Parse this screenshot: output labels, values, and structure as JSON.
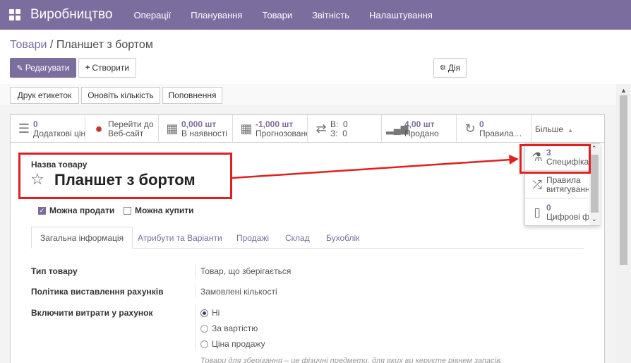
{
  "navbar": {
    "brand": "Виробництво",
    "menu": [
      "Операції",
      "Планування",
      "Товари",
      "Звітність",
      "Налаштування"
    ]
  },
  "breadcrumb": {
    "parent": "Товари",
    "separator": " / ",
    "current": "Планшет з бортом"
  },
  "buttons": {
    "edit": "Редагувати",
    "create": "Створити",
    "action": "Дія"
  },
  "header_buttons": [
    "Друк етикеток",
    "Оновіть кількість",
    "Поповнення"
  ],
  "smart_buttons": [
    {
      "icon": "list-icon",
      "value": "0",
      "label": "Додаткові ціни"
    },
    {
      "icon": "globe-icon",
      "value": "Перейти до",
      "label": "Веб-сайт"
    },
    {
      "icon": "cubes-icon",
      "value": "0,000 шт",
      "label": "В наявності"
    },
    {
      "icon": "cubes-forecast-icon",
      "value": "-1,000 шт",
      "label": "Прогнозовано"
    },
    {
      "icon": "exchange-icon",
      "value": "В:  0",
      "label": "З:  0"
    },
    {
      "icon": "signal-icon",
      "value": "4,00 шт",
      "label": "Продано"
    },
    {
      "icon": "refresh-icon",
      "value": "0",
      "label": "Правила поповнення"
    }
  ],
  "more_label": "Більше",
  "dropdown": [
    {
      "icon": "flask-icon",
      "value": "3",
      "label": "Специфікації"
    },
    {
      "icon": "shuffle-icon",
      "value": "Правила",
      "label": "витягування"
    },
    {
      "icon": "file-icon",
      "value": "0",
      "label": "Цифрові файли"
    }
  ],
  "form": {
    "name_label": "Назва товару",
    "product_name": "Планшет з бортом",
    "can_sell": "Можна продати",
    "can_buy": "Можна купити",
    "tabs": [
      "Загальна інформація",
      "Атрибути та Варіанти",
      "Продажі",
      "Склад",
      "Бухоблік"
    ],
    "fields": [
      {
        "label": "Тип товару",
        "value": "Товар, що зберігається"
      },
      {
        "label": "Політика виставлення рахунків",
        "value": "Замовлені кількості"
      },
      {
        "label": "Включити витрати у рахунок",
        "value": ""
      }
    ],
    "radio_options": [
      "Ні",
      "За вартістю",
      "Ціна продажу"
    ],
    "hint": "Товари для зберігання – це фізичні предмети, для яких ви керуєте рівнем запасів."
  },
  "colors": {
    "primary": "#7c6d9f",
    "highlight": "#e02020"
  }
}
